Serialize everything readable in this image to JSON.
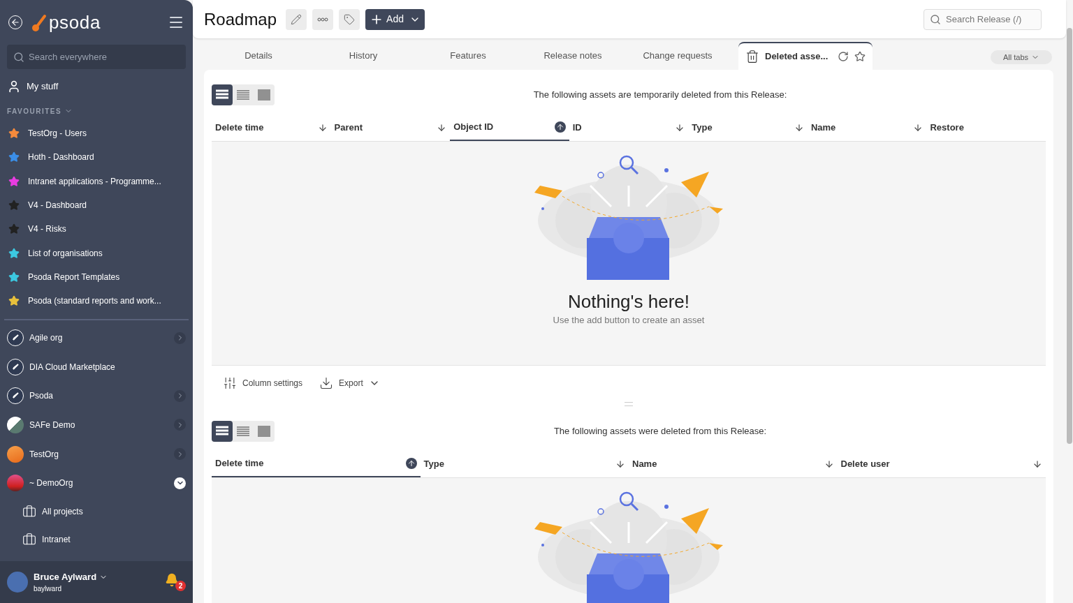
{
  "sidebar": {
    "logo": "psoda",
    "search": {
      "placeholder": "Search everywhere"
    },
    "my_stuff": "My stuff",
    "favourites_heading": "FAVOURITES",
    "favourites": [
      {
        "label": "TestOrg - Users",
        "color": "#f58a3c"
      },
      {
        "label": "Hoth - Dashboard",
        "color": "#3b8ee8"
      },
      {
        "label": "Intranet applications - Programme...",
        "color": "#e83ce0"
      },
      {
        "label": "V4 - Dashboard",
        "color": "#222222"
      },
      {
        "label": "V4 - Risks",
        "color": "#222222"
      },
      {
        "label": "List of organisations",
        "color": "#3cc8e0"
      },
      {
        "label": "Psoda Report Templates",
        "color": "#3cc8e0"
      },
      {
        "label": "Psoda (standard reports and work...",
        "color": "#e8c03c"
      }
    ],
    "orgs": [
      {
        "label": "Agile org",
        "kind": "rocket",
        "expanded": false
      },
      {
        "label": "DIA Cloud Marketplace",
        "kind": "rocket"
      },
      {
        "label": "Psoda",
        "kind": "rocket",
        "expanded": false
      },
      {
        "label": "SAFe Demo",
        "kind": "stripes",
        "expanded": false
      },
      {
        "label": "TestOrg",
        "kind": "orange",
        "expanded": false
      },
      {
        "label": "~ DemoOrg",
        "kind": "sunset",
        "expanded": true,
        "children": [
          {
            "label": "All projects"
          },
          {
            "label": "Intranet"
          }
        ]
      }
    ],
    "user": {
      "name": "Bruce Aylward",
      "username": "baylward",
      "notifications": "2"
    }
  },
  "header": {
    "title": "Roadmap",
    "add_button": "Add",
    "search": {
      "placeholder": "Search Release (/)"
    }
  },
  "tabs": [
    {
      "label": "Details",
      "selected": false
    },
    {
      "label": "History",
      "selected": false
    },
    {
      "label": "Features",
      "selected": false
    },
    {
      "label": "Release notes",
      "selected": false
    },
    {
      "label": "Change requests",
      "selected": false
    },
    {
      "label": "Deleted asse...",
      "selected": true
    }
  ],
  "all_tabs": "All tabs",
  "sections": [
    {
      "density": [
        {
          "selected": true
        },
        {
          "selected": false
        },
        {
          "selected": false
        }
      ],
      "caption": "The following assets are temporarily deleted from this Release:",
      "columns": [
        {
          "label": "Delete time",
          "kind": "sortable",
          "sorted": false
        },
        {
          "label": "Parent",
          "kind": "sortable",
          "sorted": false
        },
        {
          "label": "Object ID",
          "kind": "sortable",
          "sorted": true
        },
        {
          "label": "ID",
          "kind": "sortable",
          "sorted": false
        },
        {
          "label": "Type",
          "kind": "sortable",
          "sorted": false
        },
        {
          "label": "Name",
          "kind": "sortable",
          "sorted": false
        },
        {
          "label": "Restore",
          "kind": "plain"
        }
      ],
      "empty": {
        "title": "Nothing's here!",
        "message": "Use the add button to create an asset"
      },
      "toolbar": {
        "column_settings": "Column settings",
        "export": "Export"
      }
    },
    {
      "density": [
        {
          "selected": true
        },
        {
          "selected": false
        },
        {
          "selected": false
        }
      ],
      "caption": "The following assets were deleted from this Release:",
      "columns": [
        {
          "label": "Delete time",
          "kind": "sortable",
          "sorted": true
        },
        {
          "label": "Type",
          "kind": "sortable",
          "sorted": false
        },
        {
          "label": "Name",
          "kind": "sortable",
          "sorted": false
        },
        {
          "label": "Delete user",
          "kind": "sortable",
          "sorted": false
        }
      ]
    }
  ]
}
